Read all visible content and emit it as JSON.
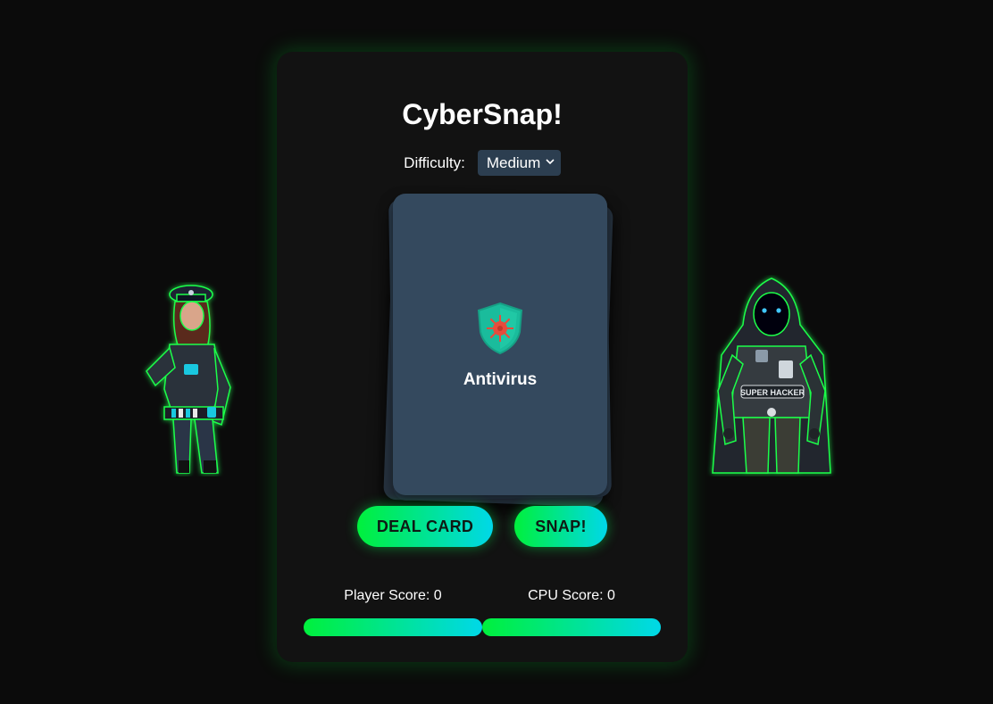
{
  "game": {
    "title": "CyberSnap!",
    "difficulty_label": "Difficulty:",
    "difficulty_selected": "Medium"
  },
  "card": {
    "label": "Antivirus",
    "icon": "antivirus-shield-icon"
  },
  "buttons": {
    "deal": "DEAL CARD",
    "snap": "SNAP!"
  },
  "scores": {
    "player_label": "Player Score: 0",
    "cpu_label": "CPU Score: 0",
    "player": 0,
    "cpu": 0
  },
  "characters": {
    "player": "police-officer-character",
    "cpu": "hacker-character",
    "hacker_badge": "SUPER HACKER"
  },
  "colors": {
    "accent_green": "#00f03c",
    "accent_cyan": "#00d8e8",
    "card": "#34495e",
    "panel": "#121212",
    "background": "#0b0b0b"
  }
}
